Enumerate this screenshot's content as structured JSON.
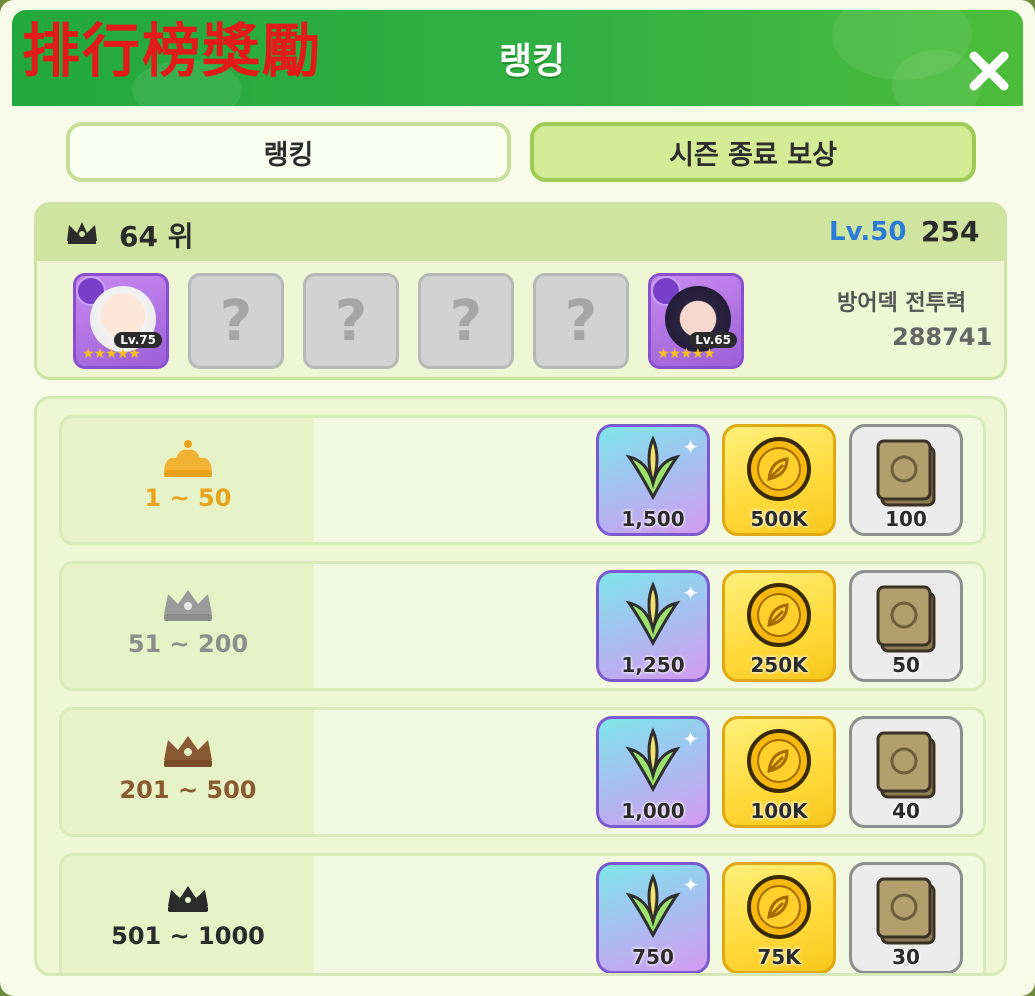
{
  "overlay_caption": "排行榜獎勵",
  "header": {
    "title": "랭킹"
  },
  "tabs": [
    {
      "label": "랭킹"
    },
    {
      "label": "시즌 종료 보상"
    }
  ],
  "my_rank": {
    "rank": "64 위",
    "level": "Lv.50",
    "score": "254",
    "defense_power_label": "방어덱 전투력",
    "defense_power_value": "288741",
    "heroes": [
      {
        "type": "hero",
        "level": "Lv.75",
        "stars": "★★★★★"
      },
      {
        "type": "empty",
        "symbol": "?"
      },
      {
        "type": "empty",
        "symbol": "?"
      },
      {
        "type": "empty",
        "symbol": "?"
      },
      {
        "type": "empty",
        "symbol": "?"
      },
      {
        "type": "hero",
        "level": "Lv.65",
        "stars": "★★★★★"
      }
    ]
  },
  "reward_rows": [
    {
      "range": "1 ~ 50",
      "tier": "gold",
      "gem": "1,500",
      "coin": "500K",
      "card": "100"
    },
    {
      "range": "51 ~ 200",
      "tier": "silver",
      "gem": "1,250",
      "coin": "250K",
      "card": "50"
    },
    {
      "range": "201 ~ 500",
      "tier": "bronze",
      "gem": "1,000",
      "coin": "100K",
      "card": "40"
    },
    {
      "range": "501 ~ 1000",
      "tier": "black",
      "gem": "750",
      "coin": "75K",
      "card": "30"
    }
  ],
  "colors": {
    "header_green": "#33b043",
    "overlay_red": "#e21a1a",
    "gold": "#e8a21c",
    "silver": "#8d8d8d",
    "bronze": "#8a5a34",
    "black": "#2b2b2b",
    "level_blue": "#2b7bd8"
  }
}
